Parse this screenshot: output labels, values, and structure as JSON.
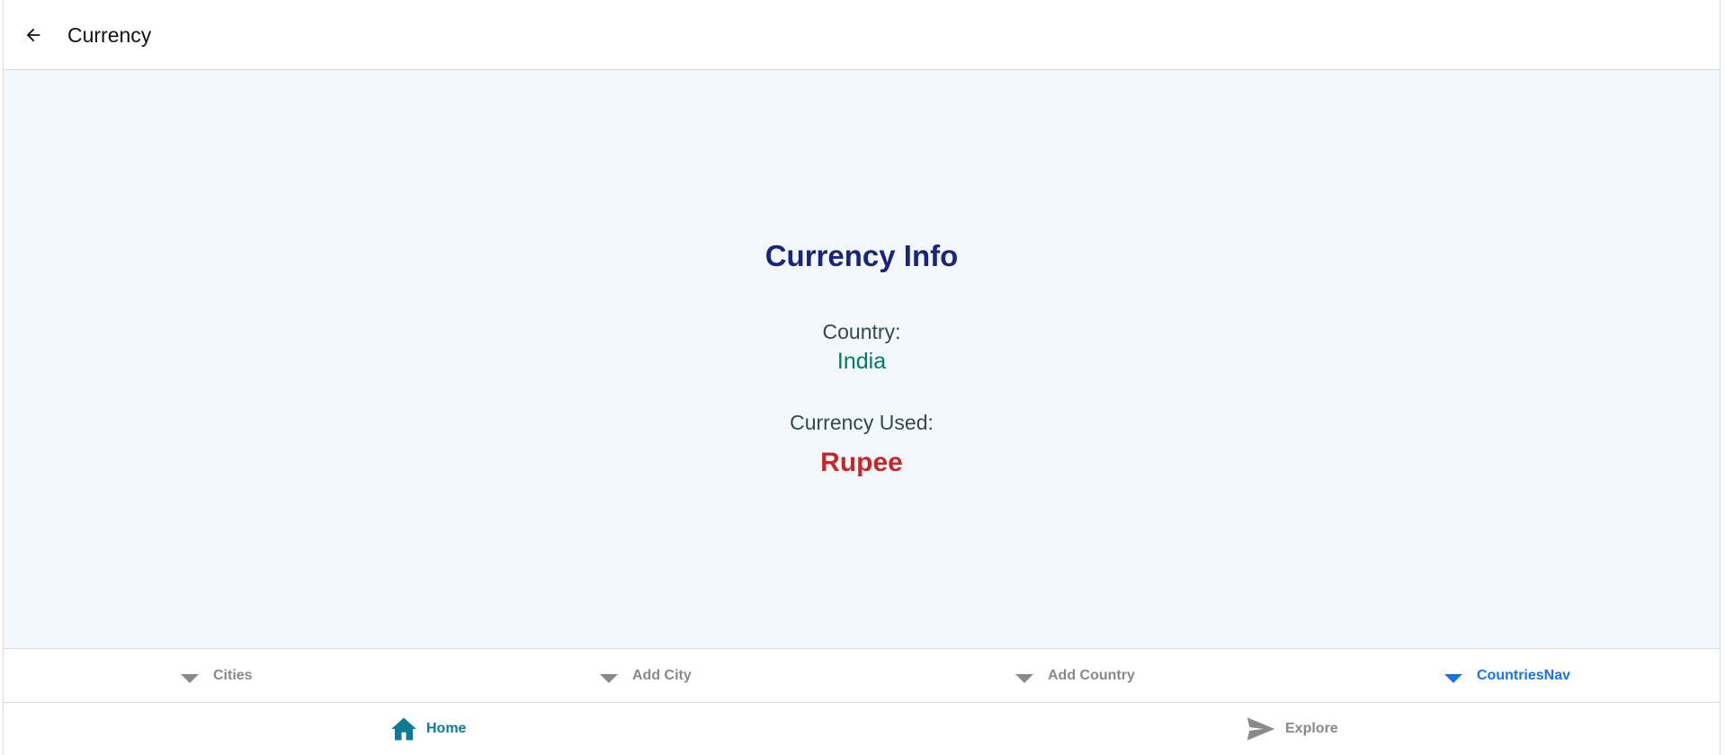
{
  "appbar": {
    "title": "Currency",
    "back_icon": "arrow-left-icon"
  },
  "info": {
    "heading": "Currency Info",
    "country_label": "Country:",
    "country_value": "India",
    "currency_label": "Currency Used:",
    "currency_value": "Rupee"
  },
  "tabs": [
    {
      "label": "Cities",
      "active": false
    },
    {
      "label": "Add City",
      "active": false
    },
    {
      "label": "Add Country",
      "active": false
    },
    {
      "label": "CountriesNav",
      "active": true
    }
  ],
  "bottom_nav": [
    {
      "label": "Home",
      "icon": "home-icon",
      "active": true
    },
    {
      "label": "Explore",
      "icon": "send-icon",
      "active": false
    }
  ],
  "colors": {
    "heading": "#1a237e",
    "country_value": "#00796b",
    "currency_value": "#c62828",
    "active_tab": "#1a73e8",
    "active_nav": "#0e7a94",
    "content_bg": "#f3f8fc"
  }
}
